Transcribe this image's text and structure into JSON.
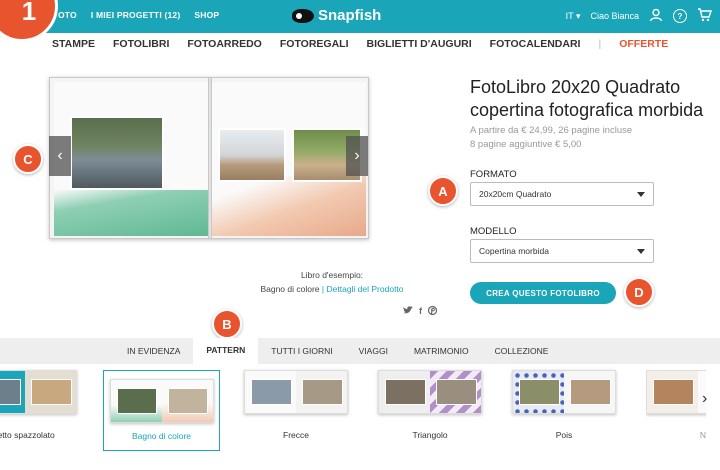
{
  "topbar": {
    "nav": [
      "OTO",
      "I MIEI PROGETTI (12)",
      "SHOP"
    ],
    "logo_text": "Snapfish",
    "language": "IT",
    "greeting": "Ciao Bianca"
  },
  "step_badge": "1",
  "categories": [
    "STAMPE",
    "FOTOLIBRI",
    "FOTOARREDO",
    "FOTOREGALI",
    "BIGLIETTI D'AUGURI",
    "FOTOCALENDARI",
    "|",
    "OFFERTE"
  ],
  "product": {
    "title": "FotoLibro 20x20 Quadrato copertina fotografica morbida",
    "price_line1": "A partire da € 24,99, 26 pagine incluse",
    "price_line2": "8 pagine aggiuntive € 5,00",
    "format_label": "FORMATO",
    "format_value": "20x20cm Quadrato",
    "model_label": "MODELLO",
    "model_value": "Copertina morbida",
    "cta_label": "CREA QUESTO FOTOLIBRO"
  },
  "preview": {
    "caption_line1": "Libro d'esempio:",
    "caption_theme": "Bagno di colore",
    "caption_sep": "|",
    "caption_link": "Dettagli del Prodotto",
    "prev_arrow": "‹",
    "next_arrow": "›"
  },
  "social": [
    "twitter-icon",
    "facebook-icon",
    "pinterest-icon"
  ],
  "badges": {
    "a": "A",
    "b": "B",
    "c": "C",
    "d": "D"
  },
  "tabs": [
    "IN EVIDENZA",
    "PATTERN",
    "TUTTI I GIORNI",
    "VIAGGI",
    "MATRIMONIO",
    "COLLEZIONE"
  ],
  "active_tab": "PATTERN",
  "themes": [
    "fetto spazzolato",
    "Bagno di colore",
    "Frecce",
    "Triangolo",
    "Pois",
    "N"
  ],
  "selected_theme": "Bagno di colore",
  "colors": {
    "brand": "#1aa6b8",
    "accent": "#e8542e"
  }
}
